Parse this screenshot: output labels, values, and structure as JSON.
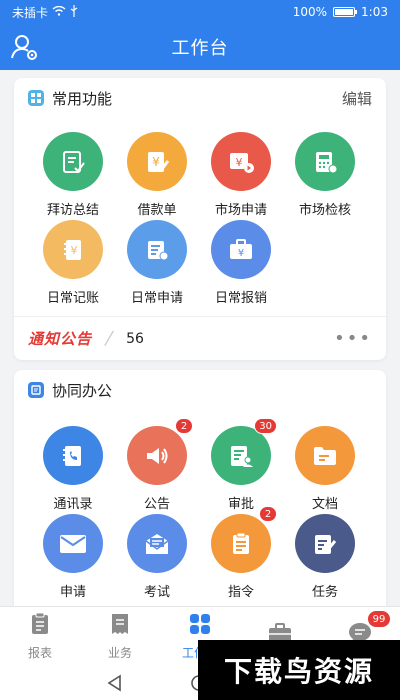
{
  "status_bar": {
    "carrier": "未插卡",
    "battery": "100%",
    "battery_level": 1.0,
    "time": "1:03"
  },
  "header": {
    "title": "工作台",
    "user_icon": "user-settings-icon"
  },
  "common": {
    "title": "常用功能",
    "edit": "编辑",
    "items": [
      {
        "label": "拜访总结",
        "icon": "visit-summary-icon",
        "color": "#3db37a"
      },
      {
        "label": "借款单",
        "icon": "loan-icon",
        "color": "#f3a93b"
      },
      {
        "label": "市场申请",
        "icon": "market-apply-icon",
        "color": "#e8594a"
      },
      {
        "label": "市场检核",
        "icon": "market-check-icon",
        "color": "#3db37a"
      },
      {
        "label": "日常记账",
        "icon": "daily-ledger-icon",
        "color": "#f3ba62"
      },
      {
        "label": "日常申请",
        "icon": "daily-apply-icon",
        "color": "#5b9de8"
      },
      {
        "label": "日常报销",
        "icon": "daily-reimburse-icon",
        "color": "#5b8ce8"
      }
    ],
    "notice_brand": "通知公告",
    "notice_count": "56",
    "more": "•••"
  },
  "collab": {
    "title": "协同办公",
    "items": [
      {
        "label": "通讯录",
        "icon": "contacts-icon",
        "color": "#3d86e6",
        "badge": ""
      },
      {
        "label": "公告",
        "icon": "announcement-icon",
        "color": "#e8725a",
        "badge": "2"
      },
      {
        "label": "审批",
        "icon": "approval-icon",
        "color": "#3db37a",
        "badge": "30"
      },
      {
        "label": "文档",
        "icon": "document-icon",
        "color": "#f3983b",
        "badge": ""
      },
      {
        "label": "申请",
        "icon": "apply-mail-icon",
        "color": "#5b8ce8",
        "badge": ""
      },
      {
        "label": "考试",
        "icon": "exam-icon",
        "color": "#5b8ce8",
        "badge": ""
      },
      {
        "label": "指令",
        "icon": "instruction-icon",
        "color": "#f3983b",
        "badge": "2"
      },
      {
        "label": "任务",
        "icon": "task-icon",
        "color": "#4a5a8a",
        "badge": ""
      }
    ]
  },
  "tabbar": {
    "tabs": [
      {
        "label": "报表",
        "icon": "report-icon"
      },
      {
        "label": "业务",
        "icon": "business-icon"
      },
      {
        "label": "工作台",
        "icon": "workbench-icon"
      },
      {
        "label": "",
        "icon": "briefcase-icon"
      },
      {
        "label": "",
        "icon": "message-icon",
        "badge": "99"
      }
    ]
  },
  "watermark": "下载鸟资源",
  "colors": {
    "primary": "#2f80ec",
    "alert": "#e53935"
  }
}
